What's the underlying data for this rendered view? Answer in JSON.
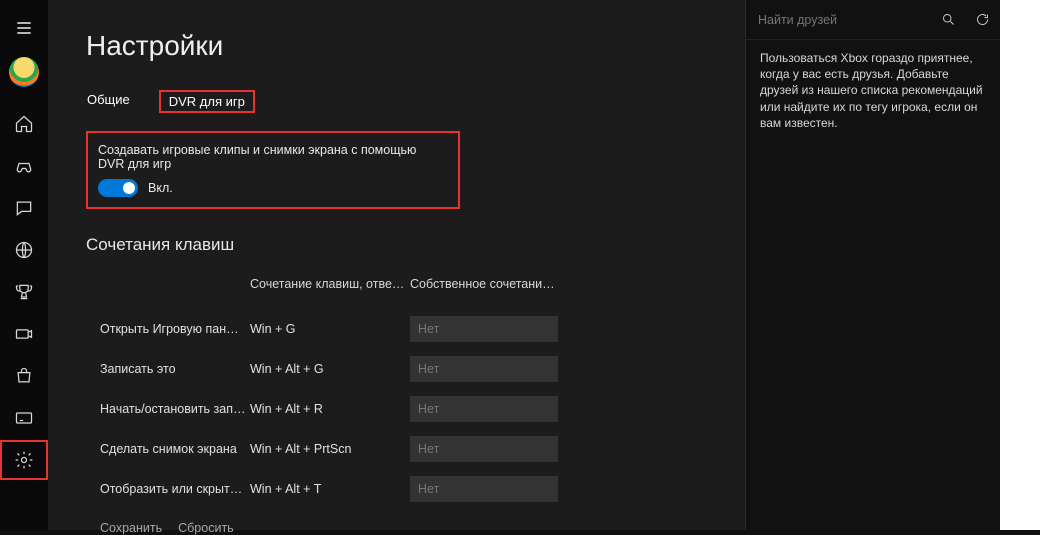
{
  "page": {
    "title": "Настройки"
  },
  "tabs": {
    "general": "Общие",
    "dvr": "DVR для игр"
  },
  "dvr_toggle": {
    "label": "Создавать игровые клипы и снимки экрана с помощью DVR для игр",
    "state": "Вкл."
  },
  "section": {
    "shortcuts_title": "Сочетания клавиш"
  },
  "headers": {
    "default": "Сочетание клавиш, отве…",
    "custom": "Собственное сочетание к…"
  },
  "shortcuts": [
    {
      "label": "Открыть Игровую пан…",
      "default": "Win + G",
      "custom_placeholder": "Нет"
    },
    {
      "label": "Записать это",
      "default": "Win + Alt + G",
      "custom_placeholder": "Нет"
    },
    {
      "label": "Начать/остановить зап…",
      "default": "Win + Alt + R",
      "custom_placeholder": "Нет"
    },
    {
      "label": "Сделать снимок экрана",
      "default": "Win + Alt + PrtScn",
      "custom_placeholder": "Нет"
    },
    {
      "label": "Отобразить или скрыт…",
      "default": "Win + Alt + T",
      "custom_placeholder": "Нет"
    }
  ],
  "footer": {
    "save": "Сохранить",
    "reset": "Сбросить"
  },
  "search": {
    "placeholder": "Найти друзей"
  },
  "hint": "Пользоваться Xbox гораздо приятнее, когда у вас есть друзья. Добавьте друзей из нашего списка рекомендаций или найдите их по тегу игрока, если он вам известен."
}
